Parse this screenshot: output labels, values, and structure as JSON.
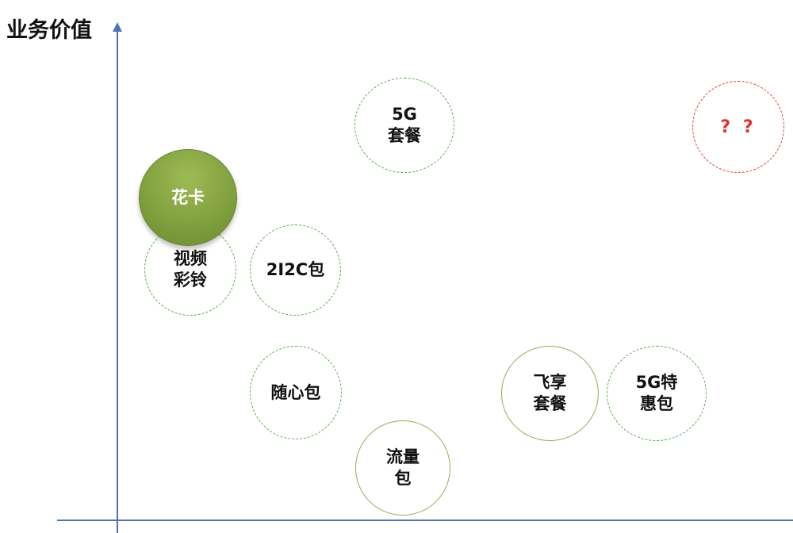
{
  "diagram": {
    "axis_title": "业务价值",
    "colors": {
      "axis": "#4f72b0",
      "dashed_green": "#5aa84f",
      "solid_olive": "#9aaa5a",
      "dashed_red": "#e23b3b",
      "filled_green": "#7f9e3d"
    },
    "nodes": [
      {
        "id": "huaka",
        "lines": [
          "花卡"
        ],
        "style": "filled-green"
      },
      {
        "id": "shipin",
        "lines": [
          "视频",
          "彩铃"
        ],
        "style": "dashed-green"
      },
      {
        "id": "2i2c",
        "lines": [
          "2I2C包"
        ],
        "style": "dashed-green"
      },
      {
        "id": "5g-taocan",
        "lines": [
          "5G",
          "套餐"
        ],
        "style": "dashed-green"
      },
      {
        "id": "unknown",
        "lines": [
          "? ?"
        ],
        "style": "dashed-red"
      },
      {
        "id": "suixin",
        "lines": [
          "随心包"
        ],
        "style": "dashed-green"
      },
      {
        "id": "feixiang",
        "lines": [
          "飞享",
          "套餐"
        ],
        "style": "solid-olive"
      },
      {
        "id": "5g-tehui",
        "lines": [
          "5G特",
          "惠包"
        ],
        "style": "dashed-green"
      },
      {
        "id": "liuliang",
        "lines": [
          "流量",
          "包"
        ],
        "style": "solid-olive"
      }
    ]
  }
}
